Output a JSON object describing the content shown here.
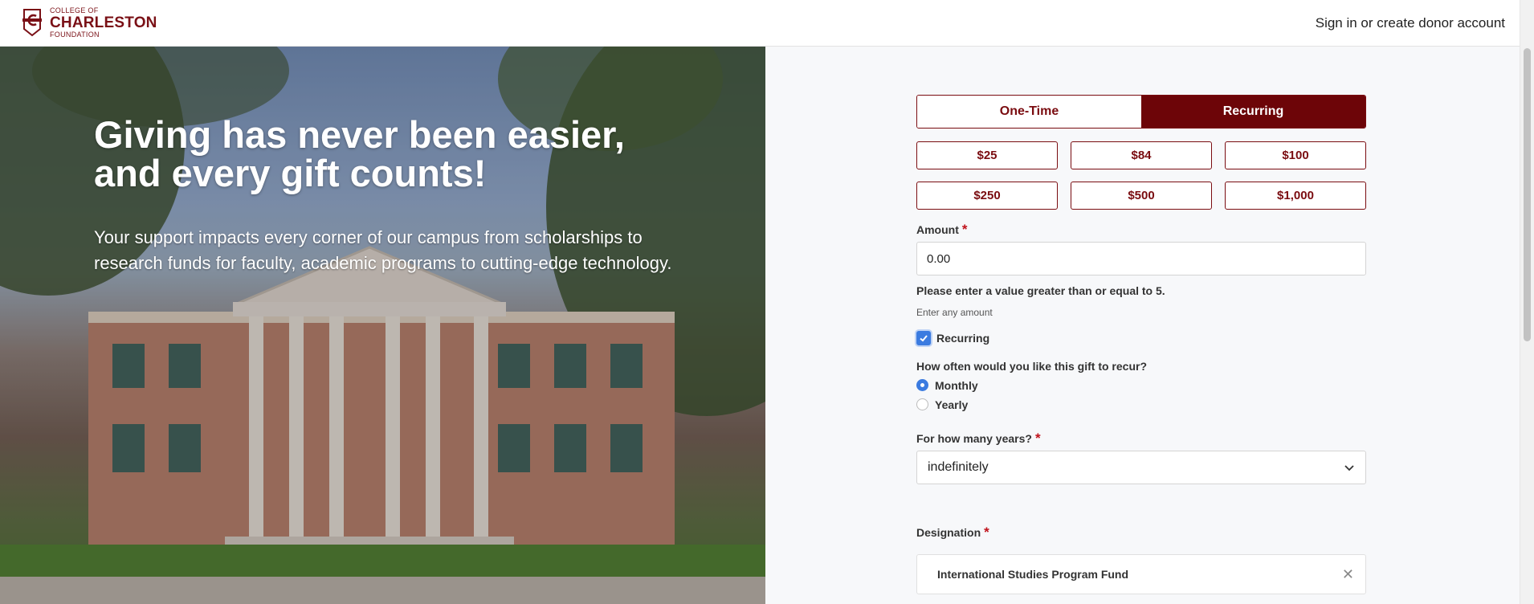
{
  "header": {
    "logo": {
      "line1": "COLLEGE OF",
      "line2": "CHARLESTON",
      "line3": "FOUNDATION",
      "brand_color": "#7a1016"
    },
    "signin_label": "Sign in or create donor account"
  },
  "hero": {
    "title": "Giving has never been easier, and every gift counts!",
    "subtitle": "Your support impacts every corner of our campus from scholarships to research funds for faculty, academic programs to cutting-edge technology."
  },
  "form": {
    "frequency": {
      "options": [
        "One-Time",
        "Recurring"
      ],
      "selected": "Recurring",
      "accent": "#6d0508"
    },
    "amount_buttons": [
      "$25",
      "$84",
      "$100",
      "$250",
      "$500",
      "$1,000"
    ],
    "amount": {
      "label": "Amount",
      "required_mark": "*",
      "value": "0.00",
      "error": "Please enter a value greater than or equal to 5.",
      "hint": "Enter any amount"
    },
    "recurring_checkbox": {
      "label": "Recurring",
      "checked": true
    },
    "recur_question": "How often would you like this gift to recur?",
    "recur_options": [
      {
        "label": "Monthly",
        "selected": true
      },
      {
        "label": "Yearly",
        "selected": false
      }
    ],
    "years": {
      "label": "For how many years?",
      "required_mark": "*",
      "selected": "indefinitely",
      "icon": "chevron-down-icon"
    },
    "designation": {
      "label": "Designation",
      "required_mark": "*",
      "value": "International Studies Program Fund",
      "remove_icon": "close-icon"
    }
  }
}
